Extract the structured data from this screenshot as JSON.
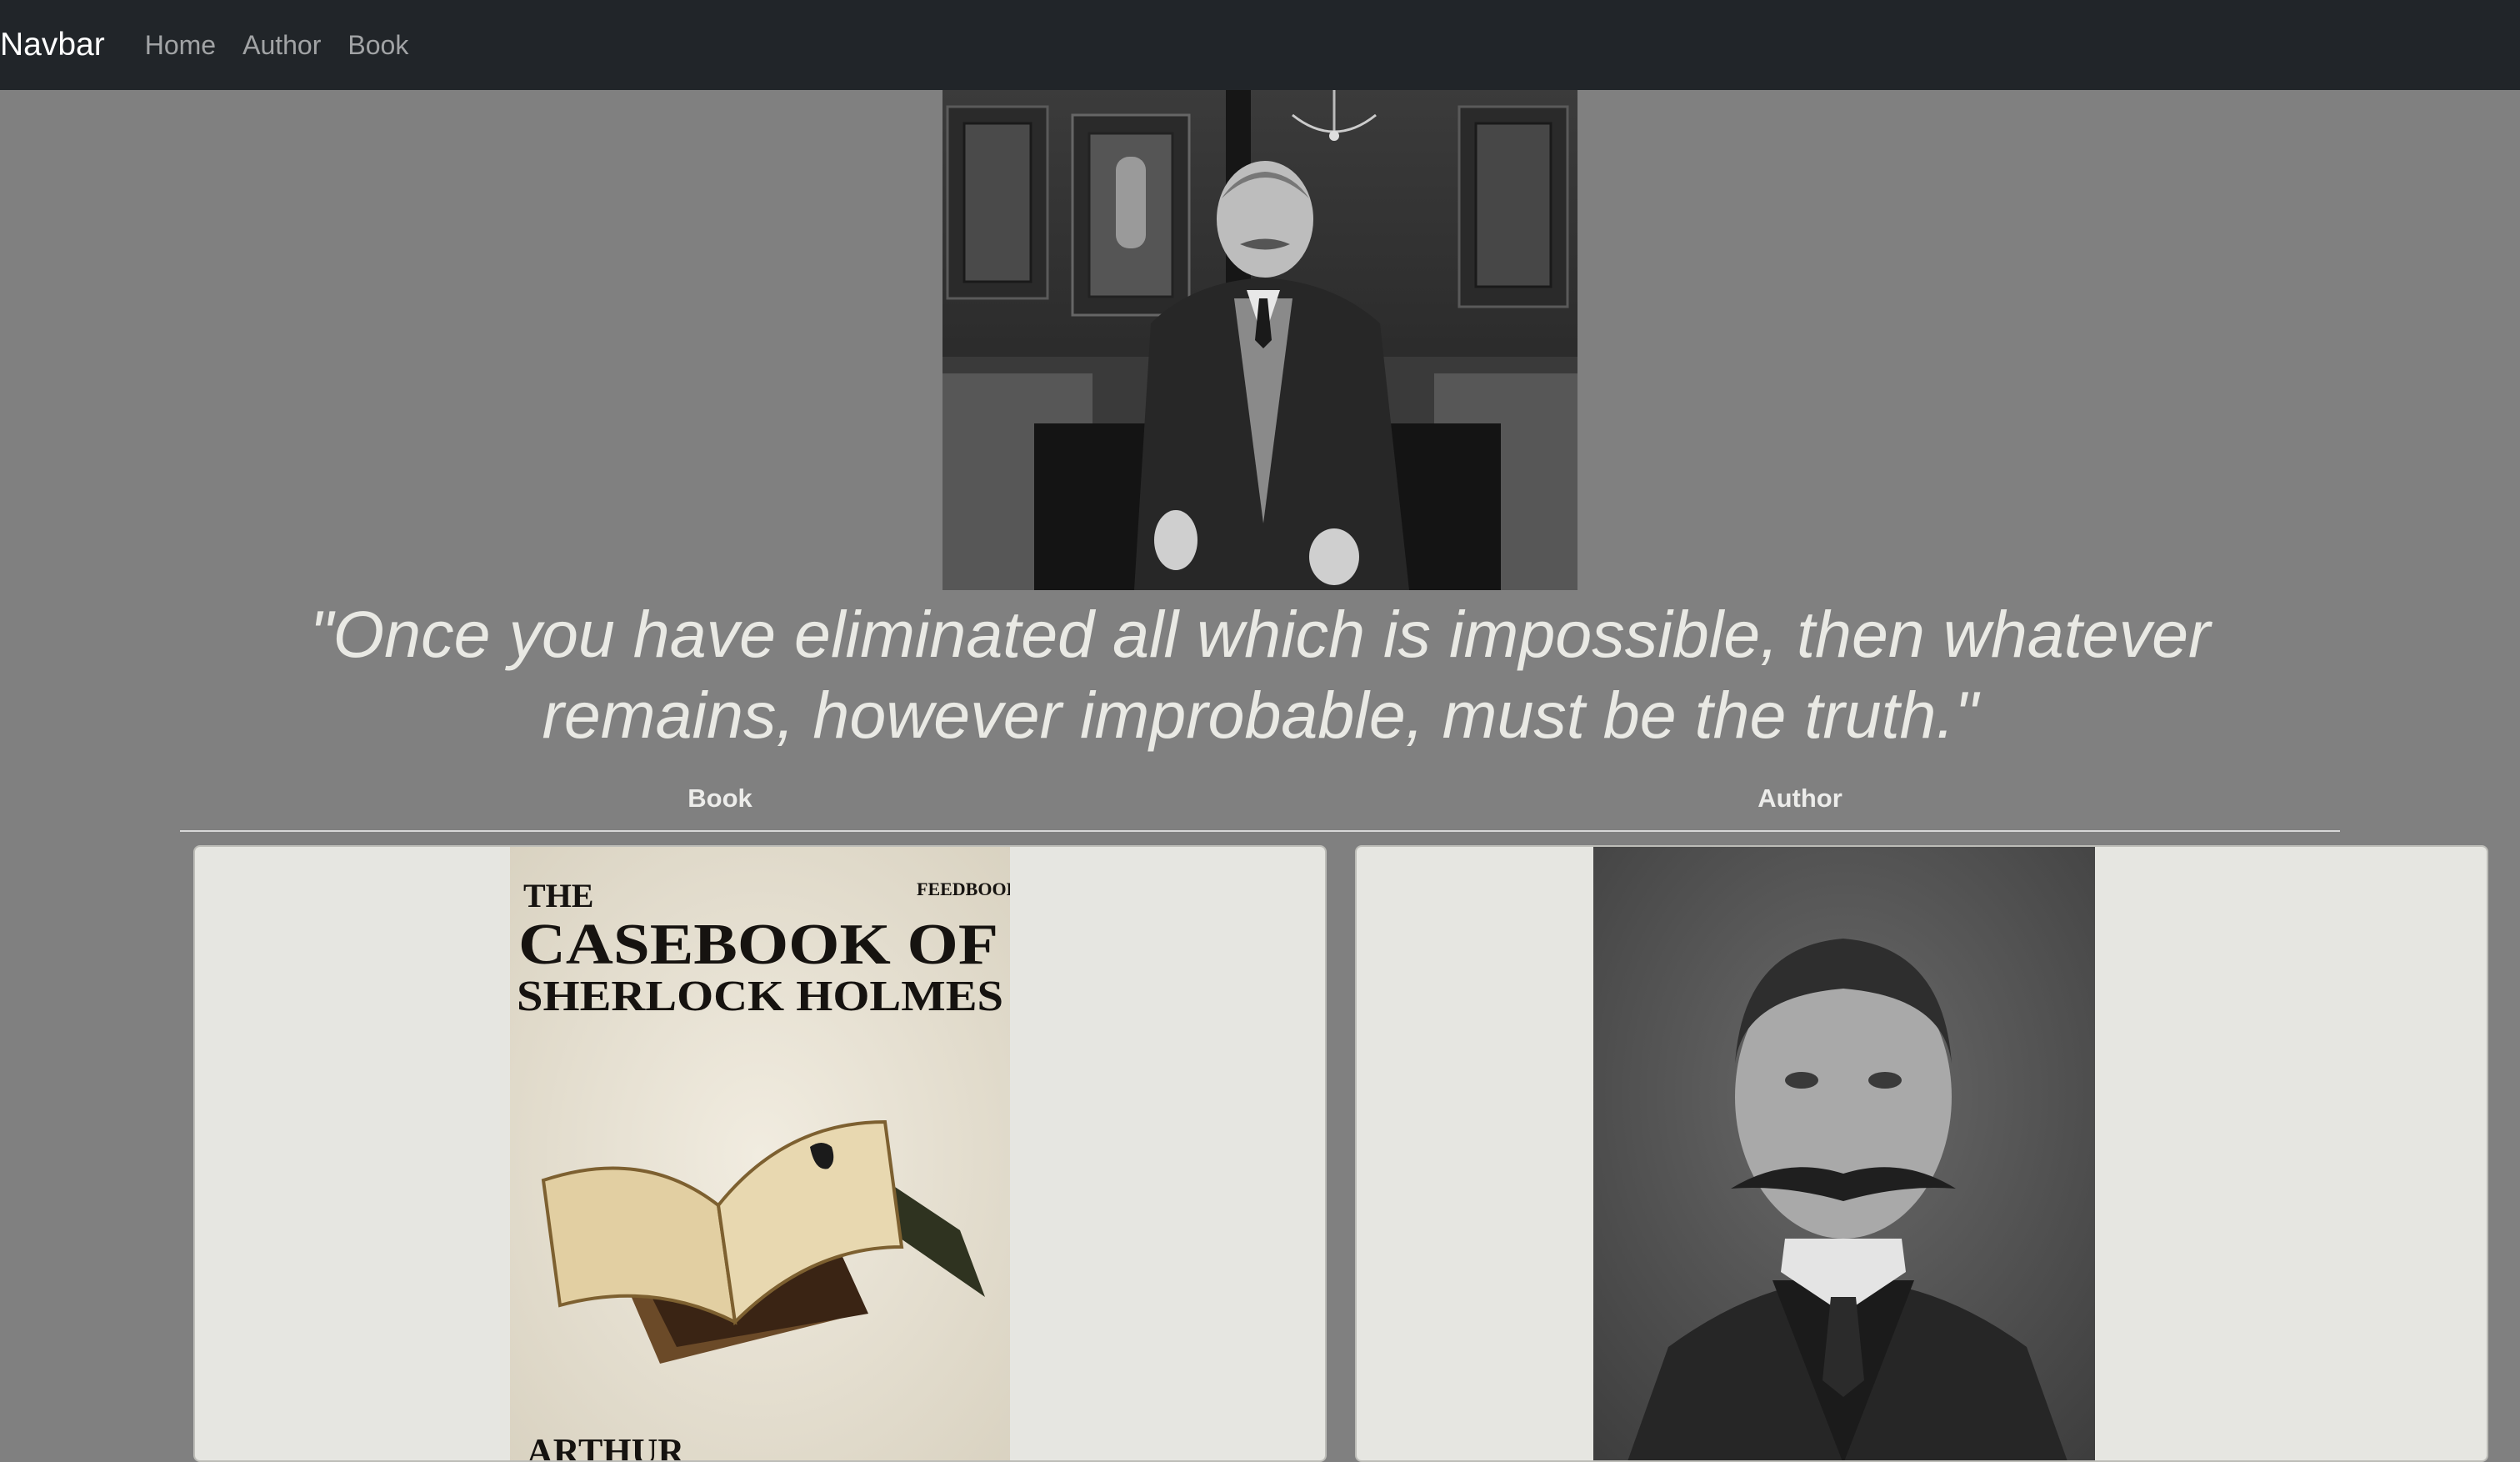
{
  "navbar": {
    "brand": "Navbar",
    "links": [
      "Home",
      "Author",
      "Book"
    ]
  },
  "quote": "\"Once you have eliminated all which is impossible, then whatever remains, however improbable, must be the truth.\"",
  "tabs": [
    "Book",
    "Author"
  ],
  "book_cover": {
    "line1": "THE",
    "line2": "CASEBOOK OF",
    "line3": "SHERLOCK HOLMES",
    "publisher": "FEEDBOOKS",
    "author_partial": "ARTHUR"
  },
  "colors": {
    "navbar_bg": "#212529",
    "page_bg": "#808080",
    "card_bg": "#e6e6e1",
    "quote_text": "#e9e9e4"
  }
}
